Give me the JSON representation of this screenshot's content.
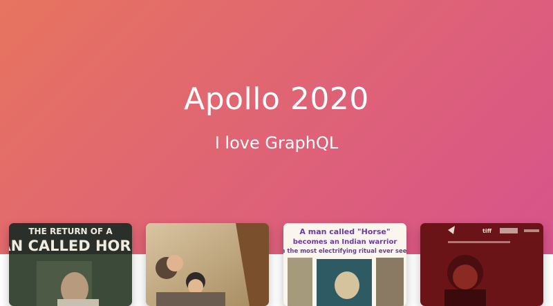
{
  "header": {
    "title": "Apollo 2020",
    "subtitle": "I love GraphQL"
  },
  "colors": {
    "gradient_start": "#e7745f",
    "gradient_end": "#d7538b",
    "text": "#ffffff"
  },
  "movies": [
    {
      "poster_line1": "THE RETURN OF A",
      "poster_line2": "AN CALLED HORS"
    },
    {
      "poster_line1": "",
      "poster_line2": ""
    },
    {
      "poster_line1": "A man called \"Horse\"",
      "poster_line2": "becomes an Indian warrior",
      "poster_line3": "in the most electrifying ritual ever seen"
    },
    {
      "poster_line1": "tiff",
      "poster_line2": ""
    }
  ]
}
